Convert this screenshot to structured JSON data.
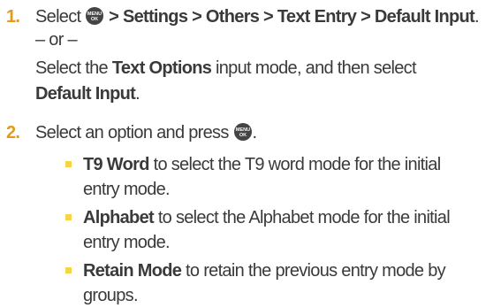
{
  "step1": {
    "number": "1.",
    "prefix": "Select",
    "path": "> Settings > Others > Text Entry > Default Input",
    "period": ".",
    "or": "– or –",
    "alt_pre": "Select the ",
    "alt_bold": "Text Options",
    "alt_post": " input mode, and then select",
    "alt_bold2": "Default Input",
    "alt_period": "."
  },
  "step2": {
    "number": "2.",
    "text_pre": "Select an option and press",
    "text_post": ".",
    "options": [
      {
        "bold": "T9 Word",
        "line1": " to select the T9 word mode for the initial",
        "line2": "entry mode."
      },
      {
        "bold": "Alphabet",
        "line1": " to select the Alphabet mode for the initial",
        "line2": "entry mode."
      },
      {
        "bold": "Retain Mode",
        "line1": " to retain the previous entry mode by",
        "line2": "groups."
      }
    ]
  },
  "icon": {
    "name": "menu-ok-key-icon",
    "top_text": "MENU",
    "bottom_text": "OK",
    "color": "#444444"
  },
  "colors": {
    "step_number": "#e39a1a",
    "bullet": "#f5d547",
    "text": "#3a3a3a"
  }
}
